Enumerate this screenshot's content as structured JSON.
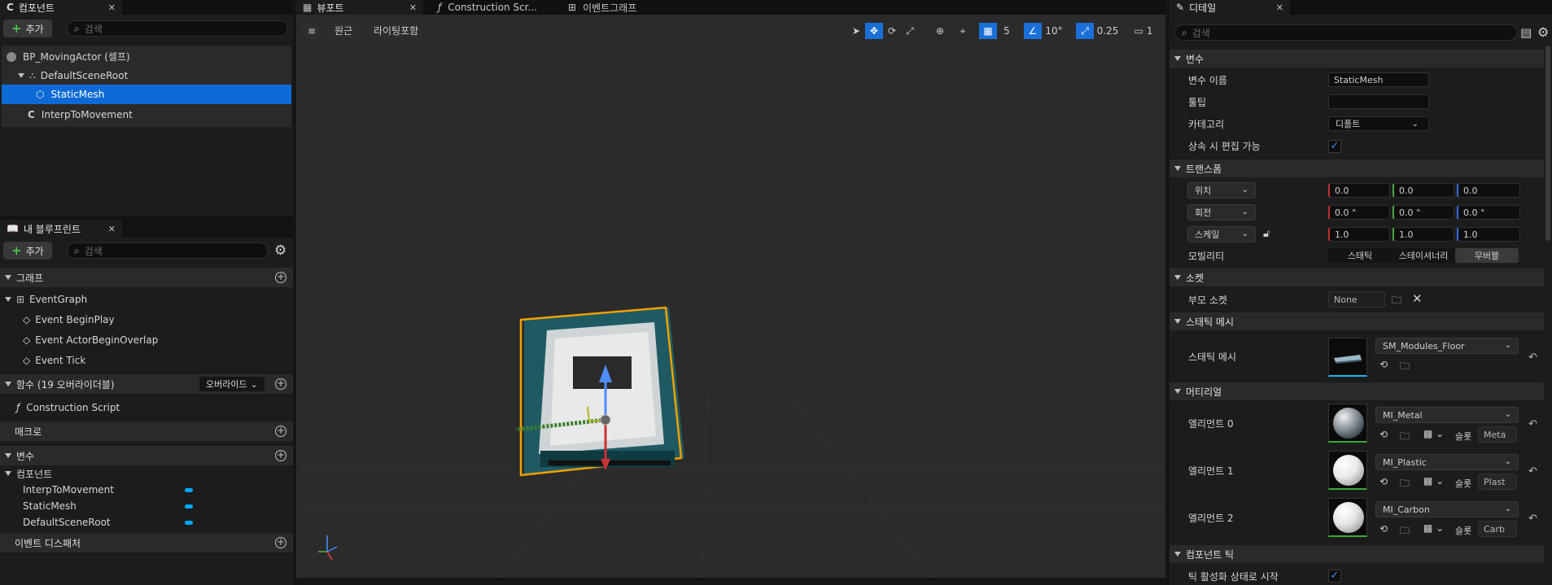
{
  "components_panel": {
    "tab_label": "컴포넌트",
    "add_label": "추가",
    "search_placeholder": "검색",
    "tree": [
      {
        "label": "BP_MovingActor (셀프)"
      },
      {
        "label": "DefaultSceneRoot"
      },
      {
        "label": "StaticMesh",
        "selected": true
      },
      {
        "label": "InterpToMovement"
      }
    ]
  },
  "blueprint_panel": {
    "tab_label": "내 블루프린트",
    "add_label": "추가",
    "search_placeholder": "검색",
    "graphs_header": "그래프",
    "event_graph": "EventGraph",
    "events": [
      "Event BeginPlay",
      "Event ActorBeginOverlap",
      "Event Tick"
    ],
    "functions_header": "함수 (19 오버라이더블)",
    "override_label": "오버라이드",
    "construction_script": "Construction Script",
    "macros_header": "매크로",
    "variables_header": "변수",
    "components_header": "컴포넌트",
    "component_vars": [
      "InterpToMovement",
      "StaticMesh",
      "DefaultSceneRoot"
    ],
    "dispatchers_header": "이벤트 디스패처"
  },
  "viewport": {
    "tabs": [
      "뷰포트",
      "Construction Scr...",
      "이벤트그래프"
    ],
    "perspective_label": "원근",
    "lighting_label": "라이팅포함",
    "grid_snap": "5",
    "rotation_snap": "10°",
    "scale_snap": "0.25",
    "camera_speed": "1",
    "accent_color": "#1b6fd8"
  },
  "details": {
    "tab_label": "디테일",
    "search_placeholder": "검색",
    "variable_section": "변수",
    "variable_name_label": "변수 이름",
    "variable_name_value": "StaticMesh",
    "tooltip_label": "툴팁",
    "tooltip_value": "",
    "category_label": "카테고리",
    "category_value": "디폴트",
    "inherit_edit_label": "상속 시 편집 가능",
    "transform_section": "트랜스폼",
    "location_label": "위치",
    "location": [
      "0.0",
      "0.0",
      "0.0"
    ],
    "rotation_label": "회전",
    "rotation": [
      "0.0 °",
      "0.0 °",
      "0.0 °"
    ],
    "scale_label": "스케일",
    "scale": [
      "1.0",
      "1.0",
      "1.0"
    ],
    "mobility_label": "모빌리티",
    "mobility_options": [
      "스태틱",
      "스테이셔너리",
      "무버블"
    ],
    "mobility_selected": "무버블",
    "sockets_section": "소켓",
    "parent_socket_label": "부모 소켓",
    "parent_socket_value": "None",
    "static_mesh_section": "스태틱 메시",
    "static_mesh_label": "스태틱 메시",
    "static_mesh_value": "SM_Modules_Floor",
    "materials_section": "머티리얼",
    "materials": [
      {
        "label": "엘리먼트 0",
        "value": "MI_Metal",
        "slot_label": "슬롯",
        "slot_value": "Meta"
      },
      {
        "label": "엘리먼트 1",
        "value": "MI_Plastic",
        "slot_label": "슬롯",
        "slot_value": "Plast"
      },
      {
        "label": "엘리먼트 2",
        "value": "MI_Carbon",
        "slot_label": "슬롯",
        "slot_value": "Carb"
      }
    ],
    "component_tick_section": "컴포넌트 틱",
    "start_tick_enabled_label": "틱 활성화 상태로 시작"
  }
}
